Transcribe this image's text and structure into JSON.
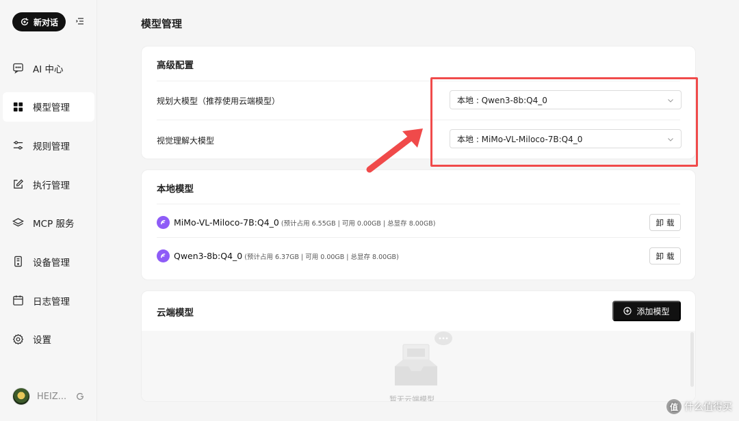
{
  "sidebar": {
    "new_chat_label": "新对话",
    "items": [
      {
        "label": "AI 中心",
        "icon": "chat-icon"
      },
      {
        "label": "模型管理",
        "icon": "grid-icon"
      },
      {
        "label": "规则管理",
        "icon": "sliders-icon"
      },
      {
        "label": "执行管理",
        "icon": "edit-icon"
      },
      {
        "label": "MCP 服务",
        "icon": "layers-icon"
      },
      {
        "label": "设备管理",
        "icon": "device-icon"
      },
      {
        "label": "日志管理",
        "icon": "calendar-icon"
      },
      {
        "label": "设置",
        "icon": "gear-icon"
      }
    ],
    "active_index": 1,
    "user_name": "HEIZ..."
  },
  "main": {
    "page_title": "模型管理",
    "advanced": {
      "title": "高级配置",
      "rows": [
        {
          "label": "规划大模型（推荐使用云端模型）",
          "value": "本地 : Qwen3-8b:Q4_0"
        },
        {
          "label": "视觉理解大模型",
          "value": "本地 : MiMo-VL-Miloco-7B:Q4_0"
        }
      ]
    },
    "local": {
      "title": "本地模型",
      "models": [
        {
          "name": "MiMo-VL-Miloco-7B:Q4_0",
          "meta": "(预计占用 6.55GB | 可用 0.00GB | 总显存 8.00GB)",
          "action": "卸载"
        },
        {
          "name": "Qwen3-8b:Q4_0",
          "meta": "(预计占用 6.37GB | 可用 0.00GB | 总显存 8.00GB)",
          "action": "卸载"
        }
      ]
    },
    "cloud": {
      "title": "云端模型",
      "add_label": "添加模型",
      "empty_text": "暂无云端模型"
    }
  },
  "watermark": {
    "badge": "值",
    "text": "什么值得买"
  },
  "colors": {
    "accent_dark": "#111111",
    "highlight_red": "#f04a4a",
    "model_logo": "#8e5cf7",
    "active_bg": "#ffffff"
  }
}
